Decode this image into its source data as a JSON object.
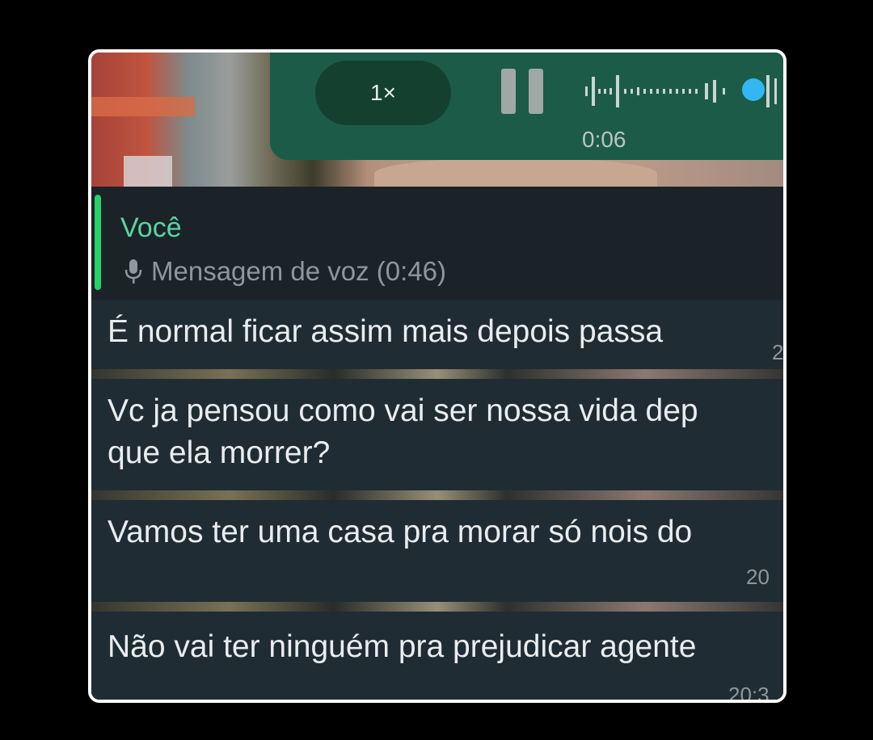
{
  "player": {
    "speed_label": "1×",
    "elapsed": "0:06",
    "progress": 0.96,
    "accent_color": "#34b7f1",
    "bar_color": "#1c5b48"
  },
  "reply": {
    "sender": "Você",
    "snippet": "Mensagem de voz (0:46)",
    "icon": "mic-icon"
  },
  "messages": [
    {
      "text": "É normal ficar assim mais depois passa",
      "time": "2"
    },
    {
      "text_line1": "Vc ja pensou como vai ser nossa vida dep",
      "text_line2": "que ela morrer?"
    },
    {
      "text": "Vamos ter uma casa pra morar só nois do",
      "time": "20"
    },
    {
      "text": "Não vai ter ninguém pra prejudicar agente",
      "time": "20:3"
    }
  ]
}
